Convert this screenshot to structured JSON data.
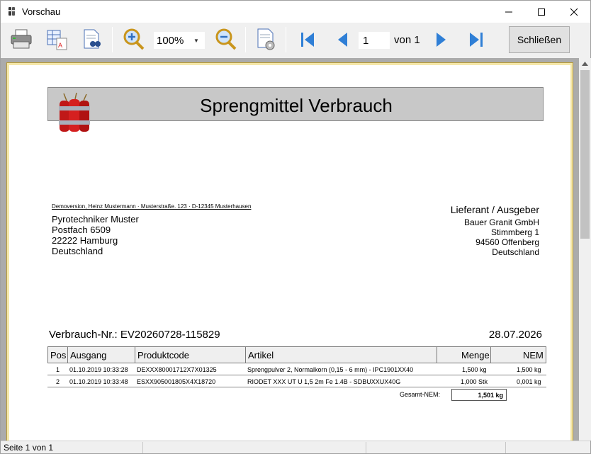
{
  "window": {
    "title": "Vorschau"
  },
  "toolbar": {
    "zoom": "100%",
    "page_current": "1",
    "page_of": "von 1",
    "close_label": "Schließen"
  },
  "report": {
    "title": "Sprengmittel Verbrauch",
    "sender_line": "Demoversion, Heinz Mustermann · Musterstraße. 123 · D-12345 Musterhausen",
    "recipient": [
      "Pyrotechniker Muster",
      "Postfach 6509",
      "22222 Hamburg",
      "Deutschland"
    ],
    "supplier_heading": "Lieferant / Ausgeber",
    "supplier": [
      "Bauer Granit GmbH",
      "Stimmberg 1",
      "94560 Offenberg",
      "Deutschland"
    ],
    "number_label": "Verbrauch-Nr.: EV20260728-115829",
    "date": "28.07.2026",
    "columns": {
      "pos": "Pos",
      "ausgang": "Ausgang",
      "produktcode": "Produktcode",
      "artikel": "Artikel",
      "menge": "Menge",
      "nem": "NEM"
    },
    "rows": [
      {
        "pos": "1",
        "ausgang": "01.10.2019 10:33:28",
        "produktcode": "DEXXX80001712X7X01325",
        "artikel": "Sprengpulver 2, Normalkorn (0,15 - 6 mm) - IPC1901XX40",
        "menge": "1,500 kg",
        "nem": "1,500 kg"
      },
      {
        "pos": "2",
        "ausgang": "01.10.2019 10:33:48",
        "produktcode": "ESXX905001805X4X18720",
        "artikel": "RIODET XXX UT U 1,5 2m Fe 1.4B - SDBUXXUX40G",
        "menge": "1,000 Stk",
        "nem": "0,001 kg"
      }
    ],
    "total_label": "Gesamt-NEM:",
    "total_value": "1,501 kg"
  },
  "status": {
    "text": "Seite 1 von 1"
  },
  "colors": {
    "header_bg": "#c8c8c8",
    "frame": "#f5e7a8",
    "nav_blue": "#2f7fd6"
  },
  "icons": [
    "print-icon",
    "export-excel-icon",
    "export-pdf-icon",
    "zoom-in-icon",
    "zoom-out-icon",
    "page-setup-icon",
    "first-page-icon",
    "prev-page-icon",
    "next-page-icon",
    "last-page-icon"
  ]
}
